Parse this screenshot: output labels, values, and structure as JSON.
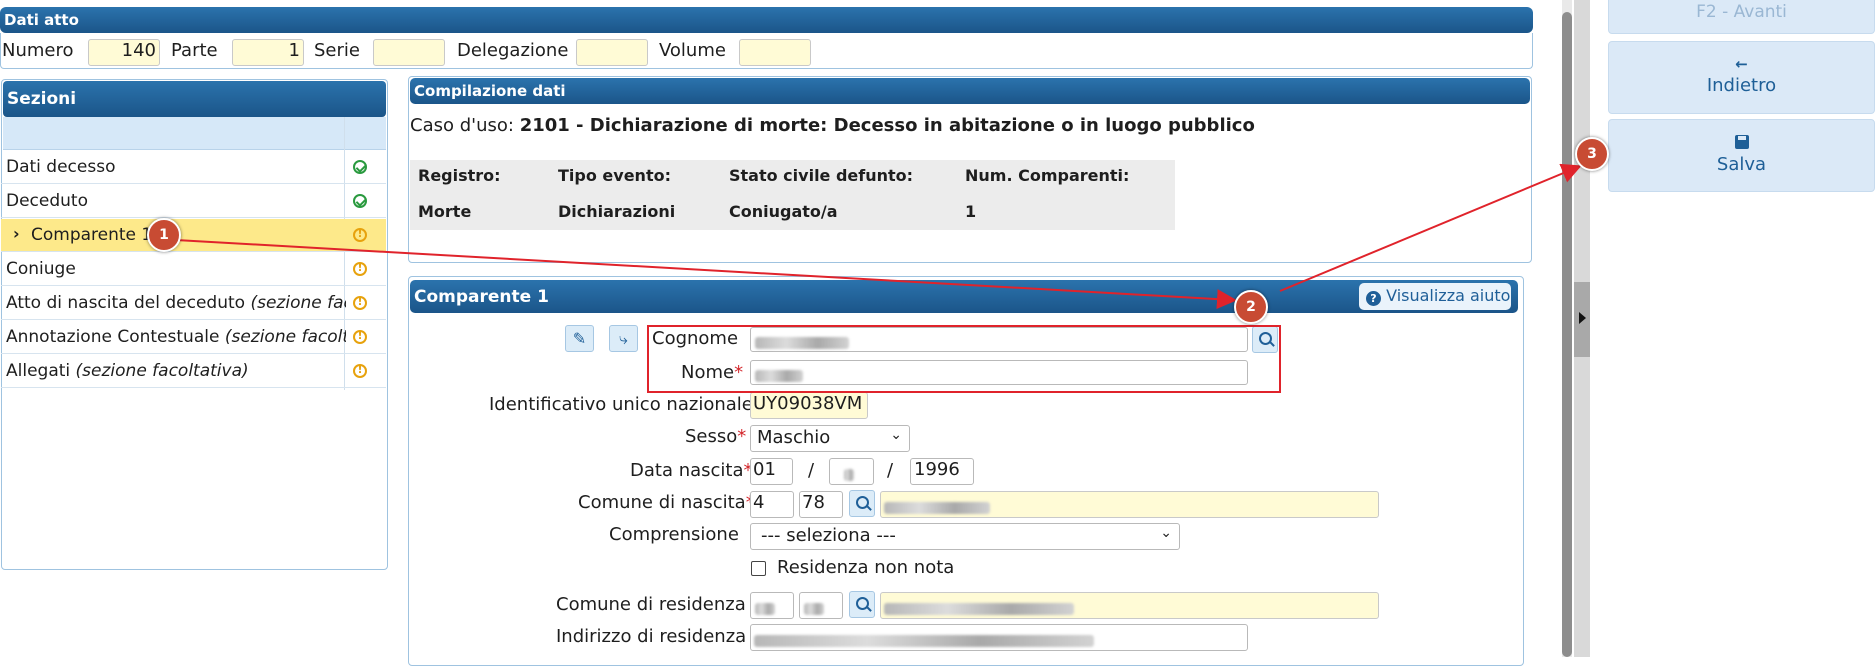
{
  "dati_atto": {
    "title": "Dati atto",
    "numero_label": "Numero",
    "numero_value": "140",
    "parte_label": "Parte",
    "parte_value": "1",
    "serie_label": "Serie",
    "serie_value": "",
    "delegazione_label": "Delegazione",
    "delegazione_value": "",
    "volume_label": "Volume",
    "volume_value": ""
  },
  "sezioni": {
    "title": "Sezioni",
    "items": [
      {
        "label": "Dati decesso",
        "optional": "",
        "status": "ok"
      },
      {
        "label": "Deceduto",
        "optional": "",
        "status": "ok"
      },
      {
        "label": "Comparente 1",
        "optional": "",
        "status": "warning",
        "selected": true
      },
      {
        "label": "Coniuge",
        "optional": "",
        "status": "warning"
      },
      {
        "label": "Atto di nascita del deceduto ",
        "optional": "(sezione facoltativa)",
        "status": "warning"
      },
      {
        "label": "Annotazione Contestuale ",
        "optional": "(sezione facoltativa)",
        "status": "warning"
      },
      {
        "label": "Allegati ",
        "optional": "(sezione facoltativa)",
        "status": "warning"
      }
    ]
  },
  "compilazione": {
    "title": "Compilazione dati",
    "caso_label": "Caso d'uso:",
    "caso_value": "2101 - Dichiarazione di morte: Decesso in abitazione o in luogo pubblico",
    "headers": [
      "Registro:",
      "Tipo evento:",
      "Stato civile defunto:",
      "Num. Comparenti:"
    ],
    "values": [
      "Morte",
      "Dichiarazioni",
      "Coniugato/a",
      "1"
    ]
  },
  "comparente": {
    "title": "Comparente 1",
    "help_label": "Visualizza aiuto",
    "cognome_label": "Cognome",
    "nome_label": "Nome",
    "id_label": "Identificativo unico nazionale",
    "id_value": "UY09038VM",
    "sesso_label": "Sesso",
    "sesso_value": "Maschio",
    "data_label": "Data nascita",
    "data_day": "01",
    "data_sep": "/",
    "data_year": "1996",
    "comune_nascita_label": "Comune di nascita",
    "comune_nascita_code1": "4",
    "comune_nascita_code2": "78",
    "comprensione_label": "Comprensione",
    "comprensione_value": "--- seleziona ---",
    "residenza_non_nota_label": "Residenza non nota",
    "comune_residenza_label": "Comune di residenza",
    "indirizzo_residenza_label": "Indirizzo di residenza",
    "required_mark": "*"
  },
  "actions": {
    "avanti_label": "F2 - Avanti",
    "indietro_label": "Indietro",
    "salva_label": "Salva"
  },
  "annotations": {
    "m1": "1",
    "m2": "2",
    "m3": "3",
    "color": "#e0232b"
  },
  "colors": {
    "header_blue": "#1b5589",
    "selected_row": "#fde98a",
    "input_yellow": "#fffbd6",
    "button_blue": "#dbe9f7"
  }
}
